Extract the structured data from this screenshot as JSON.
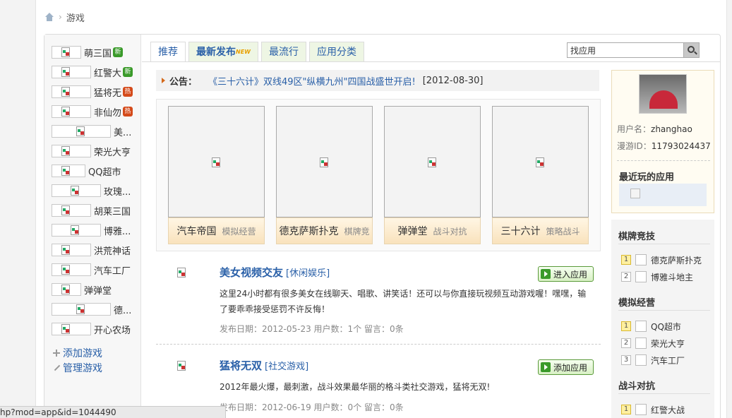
{
  "breadcrumb": {
    "current": "游戏"
  },
  "sidebar": {
    "games": [
      {
        "name": "萌三国",
        "badge": "新",
        "badge_type": "new"
      },
      {
        "name": "红警大",
        "badge": "新",
        "badge_type": "new"
      },
      {
        "name": "猛将无",
        "badge": "热",
        "badge_type": "hot"
      },
      {
        "name": "非仙勿",
        "badge": "热",
        "badge_type": "hot"
      },
      {
        "name": "美...",
        "badge": "",
        "badge_type": ""
      },
      {
        "name": "荣光大亨",
        "badge": "",
        "badge_type": ""
      },
      {
        "name": "QQ超市",
        "badge": "",
        "badge_type": ""
      },
      {
        "name": "玫瑰...",
        "badge": "",
        "badge_type": ""
      },
      {
        "name": "胡莱三国",
        "badge": "",
        "badge_type": ""
      },
      {
        "name": "博雅...",
        "badge": "",
        "badge_type": ""
      },
      {
        "name": "洪荒神话",
        "badge": "",
        "badge_type": ""
      },
      {
        "name": "汽车工厂",
        "badge": "",
        "badge_type": ""
      },
      {
        "name": "弹弹堂",
        "badge": "",
        "badge_type": ""
      },
      {
        "name": "德...",
        "badge": "",
        "badge_type": ""
      },
      {
        "name": "开心农场",
        "badge": "",
        "badge_type": ""
      }
    ],
    "add_label": "添加游戏",
    "manage_label": "管理游戏"
  },
  "tabs": [
    {
      "label": "推荐"
    },
    {
      "label": "最新发布",
      "tag": "NEW"
    },
    {
      "label": "最流行"
    },
    {
      "label": "应用分类"
    }
  ],
  "search": {
    "value": "找应用"
  },
  "notice": {
    "label": "公告：",
    "text": "《三十六计》双线49区\"纵横九州\"四国战盛世开启!",
    "date": "[2012-08-30]"
  },
  "featured": [
    {
      "name": "汽车帝国",
      "category": "模拟经营"
    },
    {
      "name": "德克萨斯扑克",
      "category": "棋牌竞"
    },
    {
      "name": "弹弹堂",
      "category": "战斗对抗"
    },
    {
      "name": "三十六计",
      "category": "策略战斗"
    }
  ],
  "apps": [
    {
      "title": "美女视频交友",
      "category": "[休闲娱乐]",
      "button": "进入应用",
      "desc": "这里24小时都有很多美女在线聊天、唱歌、讲笑话！还可以与你直接玩视频互动游戏喔！嘿嘿，输了要乖乖接受惩罚不许反悔！",
      "meta": "发布日期：2012-05-23 用户数：1个  留言：0条"
    },
    {
      "title": "猛将无双",
      "category": "[社交游戏]",
      "button": "添加应用",
      "desc": "2012年最火爆，最刺激，战斗效果最华丽的格斗类社交游戏，猛将无双!",
      "meta": "发布日期：2012-06-19 用户数：0个  留言：0条"
    }
  ],
  "profile": {
    "username_label": "用户名：",
    "username": "zhanghao",
    "id_label": "漫游ID：",
    "id": "11793024437",
    "recent_title": "最近玩的应用"
  },
  "rankings": [
    {
      "title": "棋牌竞技",
      "items": [
        "德克萨斯扑克",
        "博雅斗地主"
      ]
    },
    {
      "title": "模拟经营",
      "items": [
        "QQ超市",
        "荣光大亨",
        "汽车工厂"
      ]
    },
    {
      "title": "战斗对抗",
      "items": [
        "红警大战"
      ]
    }
  ],
  "statusbar": {
    "url": "hp?mod=app&id=1044490"
  },
  "colors": {
    "link": "#2a60a8",
    "tab_bg": "#eef6e4",
    "new_badge": "#3a9a2a",
    "hot_badge": "#d44a1a"
  }
}
